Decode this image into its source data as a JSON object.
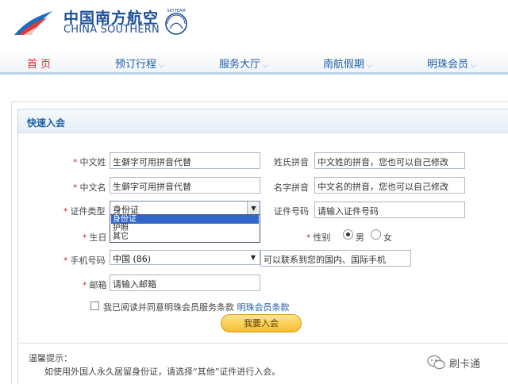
{
  "header": {
    "brand_cn": "中国南方航空",
    "brand_en": "CHINA SOUTHERN",
    "alliance": "SKYTEAM"
  },
  "nav": {
    "items": [
      {
        "label": "首 页",
        "active": true
      },
      {
        "label": "预订行程"
      },
      {
        "label": "服务大厅"
      },
      {
        "label": "南航假期"
      },
      {
        "label": "明珠会员"
      }
    ]
  },
  "panel": {
    "title": "快速入会"
  },
  "form": {
    "required_mark": "*",
    "cn_last_name": {
      "label": "中文姓",
      "value": "生僻字可用拼音代替"
    },
    "cn_first_name": {
      "label": "中文名",
      "value": "生僻字可用拼音代替"
    },
    "last_pinyin": {
      "label": "姓氏拼音",
      "value": "中文姓的拼音，您也可以自己修改"
    },
    "first_pinyin": {
      "label": "名字拼音",
      "value": "中文名的拼音，您也可以自己修改"
    },
    "id_type": {
      "label": "证件类型",
      "value": "身份证",
      "options": [
        "身份证",
        "护照",
        "其它"
      ],
      "highlighted": "身份证"
    },
    "id_number": {
      "label": "证件号码",
      "value": "请输入证件号码"
    },
    "birthday": {
      "label": "生日"
    },
    "gender": {
      "label": "性别",
      "male": "男",
      "female": "女",
      "selected": "男"
    },
    "mobile": {
      "label": "手机号码",
      "country": "中国 (86)",
      "hint": "可以联系到您的国内、国际手机"
    },
    "email": {
      "label": "邮箱",
      "value": "请输入邮箱"
    },
    "agree": {
      "text": "我已阅读并同意明珠会员服务条款",
      "link": "明珠会员条款",
      "checked": false
    },
    "submit_label": "我要入会"
  },
  "tips": {
    "title": "温馨提示：",
    "text": "如使用外国人永久居留身份证，请选择“其他”证件进行入会。"
  },
  "watermark": {
    "text": "刷卡通"
  },
  "colors": {
    "brand_blue": "#1a4e97",
    "nav_active": "#c8322d",
    "link": "#1f5fa8",
    "button": "#f5bf2c"
  }
}
